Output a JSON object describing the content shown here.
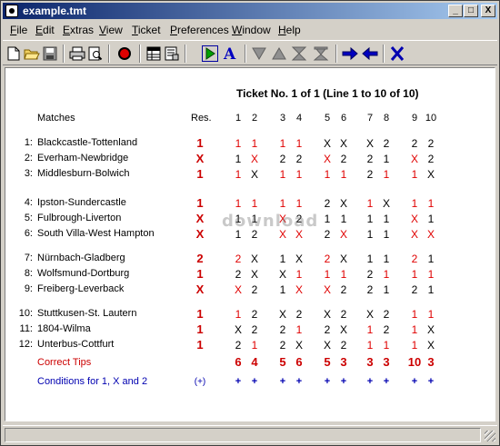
{
  "window": {
    "title": "example.tmt"
  },
  "titlebar_buttons": [
    "_",
    "□",
    "X"
  ],
  "menu": [
    {
      "label": "File",
      "u": "F",
      "rest": "ile"
    },
    {
      "label": "Edit",
      "u": "E",
      "rest": "dit"
    },
    {
      "label": "Extras",
      "u": "E",
      "rest": "xtras"
    },
    {
      "label": "View",
      "u": "V",
      "rest": "iew"
    },
    {
      "label": "Ticket",
      "u": "T",
      "rest": "icket"
    },
    {
      "label": "Preferences",
      "u": "P",
      "rest": "references"
    },
    {
      "label": "Window",
      "u": "W",
      "rest": "indow"
    },
    {
      "label": "Help",
      "u": "H",
      "rest": "elp"
    }
  ],
  "toolbar": [
    "new-icon",
    "open-icon",
    "save-icon",
    "print-icon",
    "print-preview-icon",
    "record-icon",
    "table-icon",
    "export-icon",
    "play-icon",
    "text-a-icon",
    "arrow-down-icon",
    "arrow-up-icon",
    "merge-icon",
    "merge-alt-icon",
    "arrow-right-icon",
    "arrow-left-icon",
    "close-x-icon"
  ],
  "ticket": {
    "title": "Ticket No. 1 of 1 (Line 1 to 10 of 10)",
    "matches_header": "Matches",
    "res_header": "Res.",
    "columns": [
      "1",
      "2",
      "3",
      "4",
      "5",
      "6",
      "7",
      "8",
      "9",
      "10"
    ],
    "rows": [
      {
        "n": "1:",
        "name": "Blackcastle-Tottenland",
        "res": "1",
        "tips": [
          "1",
          "1",
          "1",
          "1",
          "X",
          "X",
          "X",
          "2",
          "2",
          "2"
        ]
      },
      {
        "n": "2:",
        "name": "Everham-Newbridge",
        "res": "X",
        "tips": [
          "1",
          "X",
          "2",
          "2",
          "X",
          "2",
          "2",
          "1",
          "X",
          "2"
        ]
      },
      {
        "n": "3:",
        "name": "Middlesburn-Bolwich",
        "res": "1",
        "tips": [
          "1",
          "X",
          "1",
          "1",
          "1",
          "1",
          "2",
          "1",
          "1",
          "X"
        ]
      },
      {
        "n": "4:",
        "name": "Ipston-Sundercastle",
        "res": "1",
        "tips": [
          "1",
          "1",
          "1",
          "1",
          "2",
          "X",
          "1",
          "X",
          "1",
          "1"
        ]
      },
      {
        "n": "5:",
        "name": "Fulbrough-Liverton",
        "res": "X",
        "tips": [
          "1",
          "1",
          "X",
          "2",
          "1",
          "1",
          "1",
          "1",
          "X",
          "1"
        ]
      },
      {
        "n": "6:",
        "name": "South Villa-West Hampton",
        "res": "X",
        "tips": [
          "1",
          "2",
          "X",
          "X",
          "2",
          "X",
          "1",
          "1",
          "X",
          "X"
        ]
      },
      {
        "n": "7:",
        "name": "Nürnbach-Gladberg",
        "res": "2",
        "tips": [
          "2",
          "X",
          "1",
          "X",
          "2",
          "X",
          "1",
          "1",
          "2",
          "1"
        ]
      },
      {
        "n": "8:",
        "name": "Wolfsmund-Dortburg",
        "res": "1",
        "tips": [
          "2",
          "X",
          "X",
          "1",
          "1",
          "1",
          "2",
          "1",
          "1",
          "1"
        ]
      },
      {
        "n": "9:",
        "name": "Freiberg-Leverback",
        "res": "X",
        "tips": [
          "X",
          "2",
          "1",
          "X",
          "X",
          "2",
          "2",
          "1",
          "2",
          "1"
        ]
      },
      {
        "n": "10:",
        "name": "Stuttkusen-St. Lautern",
        "res": "1",
        "tips": [
          "1",
          "2",
          "X",
          "2",
          "X",
          "2",
          "X",
          "2",
          "1",
          "1"
        ]
      },
      {
        "n": "11:",
        "name": "1804-Wilma",
        "res": "1",
        "tips": [
          "X",
          "2",
          "2",
          "1",
          "2",
          "X",
          "1",
          "2",
          "1",
          "X"
        ]
      },
      {
        "n": "12:",
        "name": "Unterbus-Cottfurt",
        "res": "1",
        "tips": [
          "2",
          "1",
          "2",
          "X",
          "X",
          "2",
          "1",
          "1",
          "1",
          "X"
        ]
      }
    ],
    "correct_label": "Correct Tips",
    "correct": [
      "6",
      "4",
      "5",
      "6",
      "5",
      "3",
      "3",
      "3",
      "10",
      "3"
    ],
    "conditions_label": "Conditions for 1, X and 2",
    "conditions_mark": "(+)",
    "conditions": [
      "+",
      "+",
      "+",
      "+",
      "+",
      "+",
      "+",
      "+",
      "+",
      "+"
    ]
  },
  "watermark": "download",
  "colors": {
    "red": "#e00000",
    "blue": "#0000b0",
    "title_start": "#0a246a",
    "title_end": "#a6caf0"
  }
}
